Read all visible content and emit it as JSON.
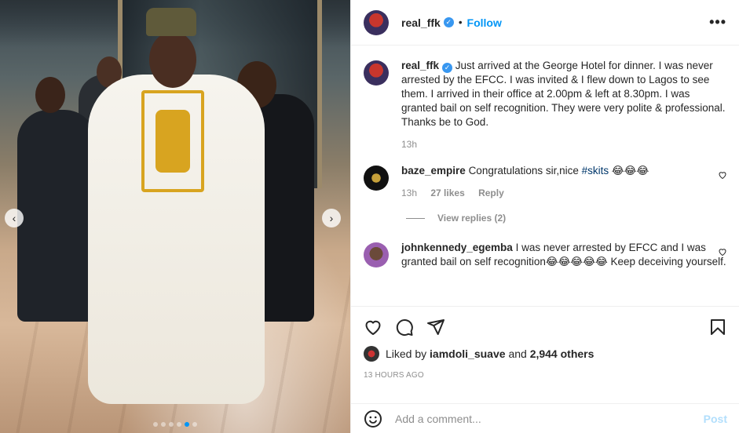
{
  "header": {
    "username": "real_ffk",
    "separator": "•",
    "follow_label": "Follow",
    "more_label": "•••"
  },
  "caption": {
    "username": "real_ffk",
    "text": "Just arrived at the George Hotel for dinner. I was never arrested by the EFCC. I was invited & I flew down to Lagos to see them. I arrived in their office at 2.00pm & left at 8.30pm. I was granted bail on self recognition. They were very polite & professional. Thanks be to God.",
    "time": "13h"
  },
  "comments": [
    {
      "username": "baze_empire",
      "text_before": "Congratulations sir,nice ",
      "hashtag": "#skits",
      "text_after": " 😂😂😂",
      "time": "13h",
      "likes": "27 likes",
      "reply_label": "Reply",
      "view_replies": "View replies (2)"
    },
    {
      "username": "johnkennedy_egemba",
      "text": "I was never arrested by EFCC and I was granted bail on self recognition😂😂😂😂😂 Keep deceiving yourself."
    }
  ],
  "likes": {
    "prefix": "Liked by",
    "user": "iamdoli_suave",
    "and": "and",
    "others": "2,944 others"
  },
  "timestamp": "13 HOURS AGO",
  "add_comment": {
    "placeholder": "Add a comment...",
    "post_label": "Post"
  },
  "carousel": {
    "total_slides": 6,
    "active_slide": 5
  },
  "colors": {
    "accent": "#0095f6",
    "verified": "#3897f0",
    "muted": "#8e8e8e",
    "post_disabled": "#b2dffc"
  },
  "icons": [
    "chevron-left-icon",
    "chevron-right-icon",
    "more-icon",
    "heart-icon",
    "comment-icon",
    "share-icon",
    "bookmark-icon",
    "emoji-icon",
    "verified-icon"
  ]
}
